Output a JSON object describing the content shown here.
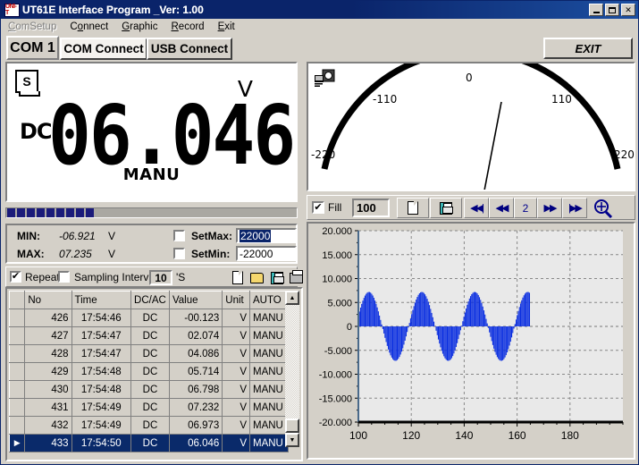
{
  "window": {
    "title": "UT61E Interface Program _Ver: 1.00",
    "app_icon": "unit-logo-icon",
    "minimize_label": "Minimize",
    "maximize_label": "Maximize",
    "close_label": "×",
    "titlebar_color": "#0a246a"
  },
  "menu": {
    "items": [
      {
        "label": "ComSetup",
        "accel": "C",
        "disabled": true
      },
      {
        "label": "Connect",
        "accel": "o",
        "disabled": false
      },
      {
        "label": "Graphic",
        "accel": "G",
        "disabled": false
      },
      {
        "label": "Record",
        "accel": "R",
        "disabled": false
      },
      {
        "label": "Exit",
        "accel": "E",
        "disabled": false
      }
    ]
  },
  "toolbar": {
    "com_label": "COM 1",
    "tab_com_connect": "COM Connect",
    "tab_usb_connect": "USB Connect",
    "active_tab": "COM Connect",
    "exit_label": "EXIT"
  },
  "lcd": {
    "hold_indicator": "S",
    "unit": "V",
    "coupling": "DC",
    "value": "06.046",
    "range_mode": "MANU",
    "signal_blocks": 9
  },
  "minmax": {
    "min_label": "MIN:",
    "min_value": "-06.921",
    "min_unit": "V",
    "max_label": "MAX:",
    "max_value": "07.235",
    "max_unit": "V",
    "setmax_label": "SetMax:",
    "setmax_value": "22000",
    "setmax_checked": false,
    "setmax_selected": true,
    "setmin_label": "SetMin:",
    "setmin_value": "-22000",
    "setmin_checked": false
  },
  "record_toolbar": {
    "repeat_label": "Repeat",
    "repeat_checked": true,
    "repeat_mark": "✔",
    "sampling_label": "Sampling Interval",
    "sampling_checked": false,
    "sampling_value": "10",
    "sampling_unit": "'S",
    "icons": [
      "new-file-icon",
      "open-folder-icon",
      "save-disk-icon",
      "print-icon"
    ]
  },
  "table": {
    "columns": [
      "No",
      "Time",
      "DC/AC",
      "Value",
      "Unit",
      "AUTO"
    ],
    "selected_row_index": 7,
    "row_marker": "▶",
    "rows": [
      {
        "no": "426",
        "time": "17:54:46",
        "dcac": "DC",
        "value": "-00.123",
        "unit": "V",
        "auto": "MANU"
      },
      {
        "no": "427",
        "time": "17:54:47",
        "dcac": "DC",
        "value": "02.074",
        "unit": "V",
        "auto": "MANU"
      },
      {
        "no": "428",
        "time": "17:54:47",
        "dcac": "DC",
        "value": "04.086",
        "unit": "V",
        "auto": "MANU"
      },
      {
        "no": "429",
        "time": "17:54:48",
        "dcac": "DC",
        "value": "05.714",
        "unit": "V",
        "auto": "MANU"
      },
      {
        "no": "430",
        "time": "17:54:48",
        "dcac": "DC",
        "value": "06.798",
        "unit": "V",
        "auto": "MANU"
      },
      {
        "no": "431",
        "time": "17:54:49",
        "dcac": "DC",
        "value": "07.232",
        "unit": "V",
        "auto": "MANU"
      },
      {
        "no": "432",
        "time": "17:54:49",
        "dcac": "DC",
        "value": "06.973",
        "unit": "V",
        "auto": "MANU"
      },
      {
        "no": "433",
        "time": "17:54:50",
        "dcac": "DC",
        "value": "06.046",
        "unit": "V",
        "auto": "MANU"
      }
    ],
    "scroll_up": "▲",
    "scroll_down": "▼"
  },
  "gauge": {
    "icon": "computer-monitor-icon",
    "tick_labels": [
      "-220",
      "-110",
      "0",
      "110",
      "220"
    ],
    "min": -220,
    "max": 220,
    "needle_value": 6.046
  },
  "chart_toolbar": {
    "fill_label": "Fill",
    "fill_checked": true,
    "fill_mark": "✔",
    "points_value": "100",
    "new_icon": "new-file-icon",
    "save_icon": "save-disk-icon",
    "nav_first": "◀◀|",
    "nav_prev": "◀◀",
    "page_number": "2",
    "nav_next": "▶▶",
    "nav_last": "|▶▶",
    "zoom_icon": "magnifier-plus-icon"
  },
  "chart_data": {
    "type": "area",
    "title": "",
    "xlabel": "",
    "ylabel": "",
    "xlim": [
      100,
      200
    ],
    "ylim": [
      -20,
      20
    ],
    "xticks": [
      100,
      120,
      140,
      160,
      180
    ],
    "xtick_labels": [
      "100",
      "120",
      "140",
      "160",
      "180"
    ],
    "yticks": [
      -20,
      -15,
      -10,
      -5,
      0,
      5,
      10,
      15,
      20
    ],
    "ytick_labels": [
      "-20.000",
      "-15.000",
      "-10.000",
      "-5.000",
      "0",
      "5.000",
      "10.000",
      "15.000",
      "20.000"
    ],
    "grid": true,
    "legend": "none",
    "series": [
      {
        "name": "Value",
        "color": "#0a2ee0",
        "fill": true,
        "amplitude": 7.2,
        "period": 20,
        "phase_deg": 18,
        "x_start": 100,
        "x_end": 165,
        "x": [
          100,
          102,
          104,
          106,
          108,
          110,
          112,
          114,
          116,
          118,
          120,
          122,
          124,
          126,
          128,
          130,
          132,
          134,
          136,
          138,
          140,
          142,
          144,
          146,
          148,
          150,
          152,
          154,
          156,
          158,
          160,
          162,
          164,
          165
        ],
        "values": [
          2.2,
          5.1,
          7.0,
          6.9,
          4.7,
          1.3,
          -2.4,
          -5.6,
          -7.2,
          -6.6,
          -3.9,
          -0.4,
          3.2,
          6.1,
          7.2,
          5.8,
          2.8,
          -1.0,
          -4.6,
          -6.9,
          -7.1,
          -5.0,
          -1.5,
          2.3,
          5.6,
          7.2,
          6.4,
          3.7,
          0.1,
          -3.5,
          -6.3,
          -7.2,
          -5.6,
          2.0
        ]
      }
    ]
  }
}
